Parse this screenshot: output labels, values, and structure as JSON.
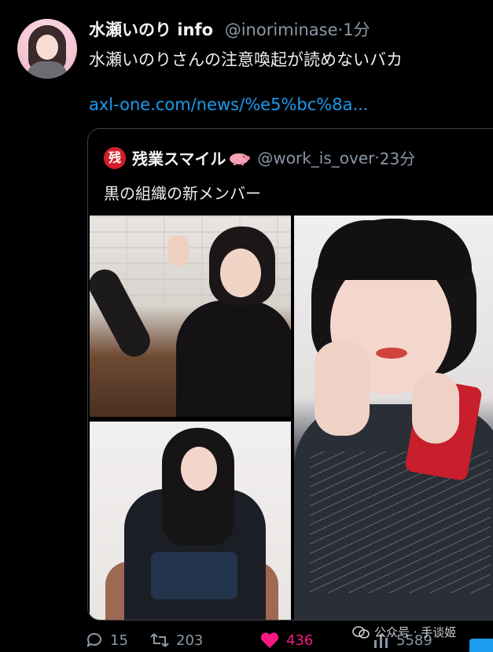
{
  "tweet": {
    "name": "水瀬いのり info",
    "handle": "@inoriminase",
    "dot": "·",
    "time": "1分",
    "text": "水瀬いのりさんの注意喚起が読めないバカ",
    "link": "axl-one.com/news/%e5%bc%8a..."
  },
  "quote": {
    "icon_char": "残",
    "name": "残業スマイル",
    "handle": "@work_is_over",
    "dot": "·",
    "time": "23分",
    "text": "黒の組織の新メンバー"
  },
  "actions": {
    "replies": "15",
    "retweets": "203",
    "likes": "436",
    "views": "5589",
    "like_color": "#f91880"
  },
  "watermark": {
    "text": "公众号 · 手谈姬"
  },
  "icons": [
    "reply-icon",
    "retweet-icon",
    "heart-icon",
    "views-icon",
    "pig-icon",
    "wechat-icon"
  ],
  "colors": {
    "background": "#000000",
    "link": "#1d9bf0",
    "muted": "#8b98a5",
    "quote_icon": "#d51e2a"
  }
}
